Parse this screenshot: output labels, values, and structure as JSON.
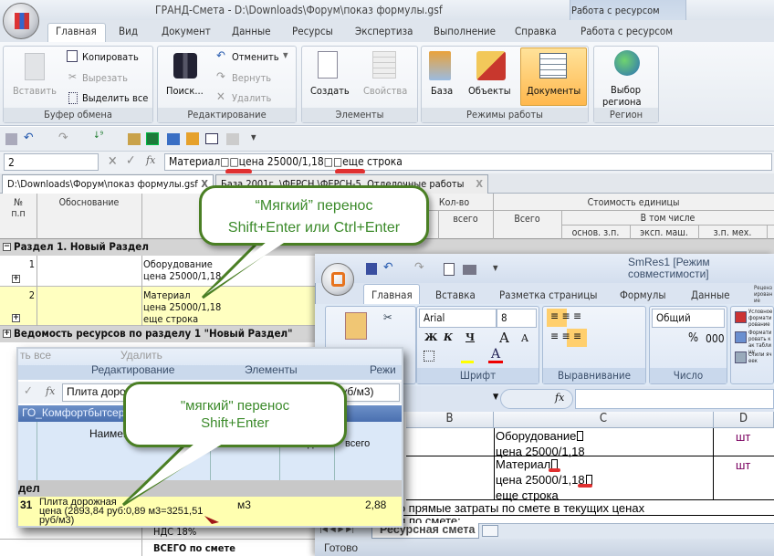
{
  "app": {
    "title": "ГРАНД-Смета - D:\\Downloads\\Форум\\показ формулы.gsf",
    "context_tab_group": "Работа с ресурсом"
  },
  "ribbon_tabs": [
    "Главная",
    "Вид",
    "Документ",
    "Данные",
    "Ресурсы",
    "Экспертиза",
    "Выполнение",
    "Справка",
    "Работа с ресурсом"
  ],
  "ribbon": {
    "clipboard": {
      "label": "Буфер обмена",
      "paste": "Вставить",
      "copy": "Копировать",
      "cut": "Вырезать",
      "select_all": "Выделить все"
    },
    "editing": {
      "label": "Редактирование",
      "search": "Поиск...",
      "undo": "Отменить",
      "redo": "Вернуть",
      "delete": "Удалить"
    },
    "elements": {
      "label": "Элементы",
      "create": "Создать",
      "properties": "Свойства"
    },
    "modes": {
      "label": "Режимы работы",
      "base": "База",
      "objects": "Объекты",
      "documents": "Документы"
    },
    "region": {
      "label": "Регион",
      "select": "Выбор",
      "select2": "региона"
    }
  },
  "formula_bar": {
    "name_box": "2",
    "value": "Материал□□цена 25000/1,18□□еще строка"
  },
  "doc_tabs": [
    "D:\\Downloads\\Форум\\показ формулы.gsf",
    "База 2001г. \\ФЕРСН \\ФЕРСН-5. Отделочные работы"
  ],
  "grid": {
    "headers": {
      "num": "№",
      "num2": "п.п",
      "basis": "Обоснование",
      "name": "Наименование",
      "qty": "Кол-во",
      "total_q": "всего",
      "cost_unit": "Стоимость единицы",
      "total": "Всего",
      "incl": "В том числе",
      "osn": "основ. з.п.",
      "eksp": "эксп. маш.",
      "zpmeh": "з.п. мех."
    },
    "section": "Раздел 1. Новый Раздел",
    "rows": [
      {
        "num": "1",
        "name": "Оборудование\nцена 25000/1,18"
      },
      {
        "num": "2",
        "name": "Материал\nцена 25000/1,18\nеще строка"
      }
    ],
    "resources": "Ведомость ресурсов по разделу 1 \"Новый Раздел\"",
    "vat": "НДС 18%",
    "grand_total": "ВСЕГО по смете"
  },
  "excel": {
    "title": "SmRes1  [Режим совместимости]",
    "tabs": [
      "Главная",
      "Вставка",
      "Разметка страницы",
      "Формулы",
      "Данные",
      "Рецензирование"
    ],
    "font": "Arial",
    "size": "8",
    "number_format": "Общий",
    "groups": {
      "font": "Шрифт",
      "align": "Выравнивание",
      "number": "Число"
    },
    "bold": "Ж",
    "italic": "К",
    "underline": "Ч",
    "percent": "%",
    "thousands": "000",
    "styles": [
      "Условное форматирование",
      "Форматировать как таблицу",
      "Стили ячеек"
    ],
    "cols": [
      "B",
      "C",
      "D"
    ],
    "cells": [
      {
        "c": "Оборудование",
        "c2": "цена 25000/1,18",
        "d": "шт"
      },
      {
        "c": "Материал",
        "c2": "цена 25000/1,18",
        "c3": "еще строка",
        "d": "шт"
      }
    ],
    "total_direct": "Итого прямые затраты по смете в текущих ценах",
    "totals": "Итоги по смете:",
    "sheet_tab": "Ресурсная смета",
    "status": "Готово"
  },
  "inset": {
    "select_all": "ть все",
    "delete": "Удалить",
    "editing": "Редактирование",
    "elements": "Элементы",
    "modes": "Режи",
    "formula": "Плита дорожная цена (2893,84 руб:0,89 м3=3251,51 руб/м3)",
    "band": "ГО_Комфортбытсервис ... доп. работы",
    "name_header": "Наименование",
    "per_unit": "на ед.",
    "total": "всего",
    "section": "дел",
    "row_num": "31",
    "row_name": "Плита дорожная\nцена (2893,84 руб:0,89 м3=3251,51\nруб/м3)",
    "unit": "м3",
    "value": "2,88"
  },
  "callouts": [
    {
      "line1": "“Мягкий” перенос",
      "line2": "Shift+Enter или Ctrl+Enter"
    },
    {
      "line1": "\"мягкий\" перенос",
      "line2": "Shift+Enter"
    }
  ],
  "colors": {
    "callout_border": "#4a7f24",
    "callout_text": "#3b8a2a",
    "highlight_row": "#ffffc0",
    "mark": "#e03030"
  }
}
